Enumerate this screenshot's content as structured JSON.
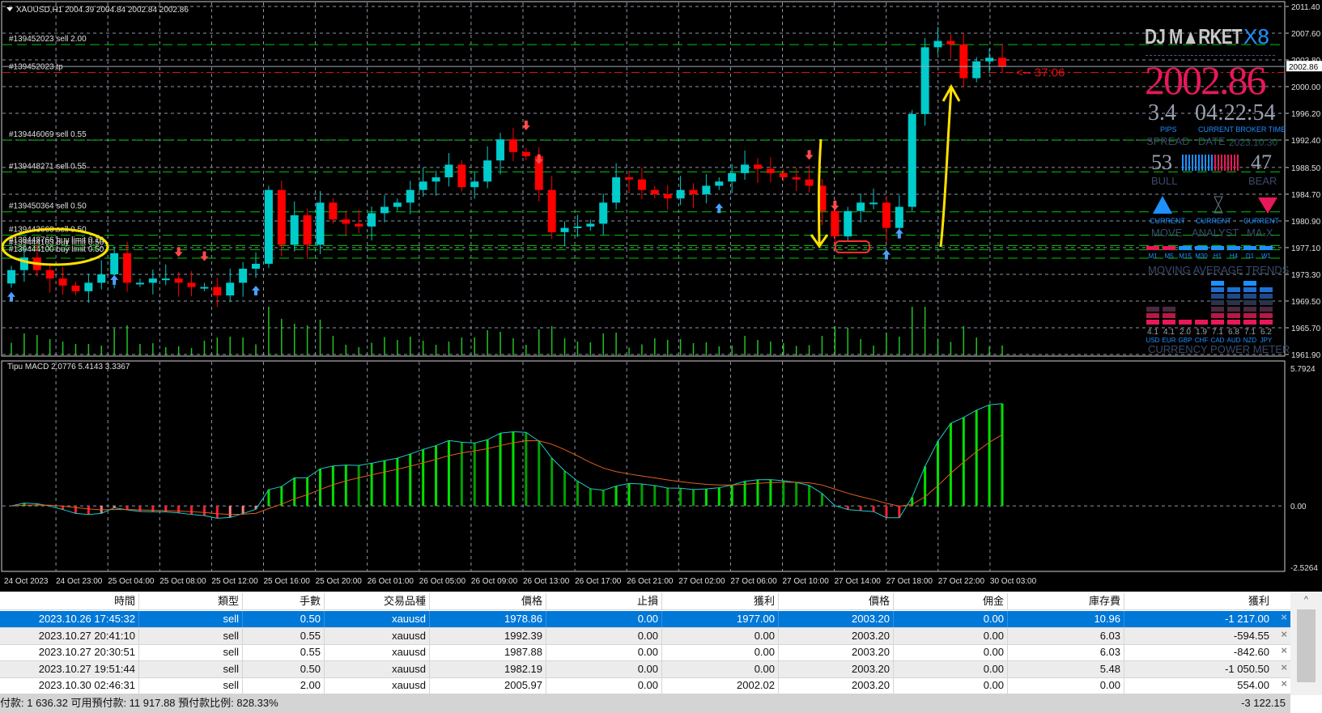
{
  "chart": {
    "title": "XAUUSD,H1",
    "ohlc_readout": "2004.39 2004.84 2002.84 2002.86",
    "price_axis": [
      "2011.40",
      "2007.60",
      "2003.80",
      "2000.00",
      "1996.20",
      "1992.40",
      "1988.50",
      "1984.70",
      "1980.90",
      "1977.10",
      "1973.30",
      "1969.50",
      "1965.70",
      "1961.90"
    ],
    "current_price": "2002.86",
    "countdown": "<-- 37:06",
    "time_axis": [
      "24 Oct 2023",
      "24 Oct 23:00",
      "25 Oct 04:00",
      "25 Oct 08:00",
      "25 Oct 12:00",
      "25 Oct 16:00",
      "25 Oct 20:00",
      "26 Oct 01:00",
      "26 Oct 05:00",
      "26 Oct 09:00",
      "26 Oct 13:00",
      "26 Oct 17:00",
      "26 Oct 21:00",
      "27 Oct 02:00",
      "27 Oct 06:00",
      "27 Oct 10:00",
      "27 Oct 14:00",
      "27 Oct 18:00",
      "27 Oct 22:00",
      "30 Oct 03:00"
    ],
    "order_lines": [
      {
        "label": "#139452023 sell 2.00",
        "price": 2005.97,
        "kind": "order"
      },
      {
        "label": "#139452023 tp",
        "price": 2002.02,
        "kind": "tp"
      },
      {
        "label": "#139446069 sell 0.55",
        "price": 1992.39,
        "kind": "order"
      },
      {
        "label": "#139448271 sell 0.55",
        "price": 1987.88,
        "kind": "order"
      },
      {
        "label": "#139450364 sell 0.50",
        "price": 1982.19,
        "kind": "order"
      },
      {
        "label": "#139443660 sell 0.50",
        "price": 1978.86,
        "kind": "order"
      },
      {
        "label": "#139448766 buy limit 0.10",
        "price": 1977.4,
        "kind": "order"
      },
      {
        "label": "#139444103 buy limit 0.50",
        "price": 1976.8,
        "kind": "order"
      },
      {
        "label": "#139444100 buy limit 0.50",
        "price": 1975.6,
        "kind": "order"
      }
    ],
    "colors": {
      "bull": "#00cccc",
      "bear": "#ff0000",
      "grid": "#8c96a6",
      "order_line": "#00c800",
      "tp_line": "#e01010",
      "volume": "#22c022",
      "macd_line": "#20c8c8",
      "signal_line": "#e06020",
      "hist_pos": "#00e000",
      "hist_neg": "#ff2030",
      "annotation": "#ffe000"
    }
  },
  "chart_data": [
    {
      "type": "candlestick",
      "title": "XAUUSD,H1",
      "ylim": [
        1961.9,
        2011.4
      ],
      "x_start": "24 Oct 2023",
      "x_end": "30 Oct 04:00",
      "close": [
        1973.9,
        1975.7,
        1973.9,
        1972.7,
        1971.7,
        1970.9,
        1972.1,
        1973.3,
        1976.3,
        1972.1,
        1972.1,
        1972.7,
        1972.7,
        1972.1,
        1971.5,
        1971.5,
        1970.3,
        1972.1,
        1974.1,
        1974.8,
        1985.3,
        1977.5,
        1981.7,
        1977.5,
        1983.5,
        1981.1,
        1980.5,
        1980.1,
        1982.0,
        1982.9,
        1983.5,
        1985.3,
        1986.5,
        1987.1,
        1988.9,
        1985.7,
        1986.5,
        1989.5,
        1992.5,
        1990.7,
        1990.1,
        1985.3,
        1979.3,
        1979.9,
        1980.1,
        1980.5,
        1983.5,
        1987.1,
        1986.8,
        1985.3,
        1984.7,
        1984.1,
        1985.3,
        1984.7,
        1985.9,
        1986.5,
        1987.7,
        1988.9,
        1988.3,
        1987.7,
        1987.1,
        1986.8,
        1985.9,
        1982.3,
        1978.7,
        1982.3,
        1983.5,
        1983.5,
        1979.9,
        1982.9,
        1996.1,
        2005.6,
        2006.5,
        2006.0,
        2001.2,
        2003.6,
        2004.1,
        2002.86
      ],
      "first_open": 1972.0,
      "signals": [
        {
          "i": 13,
          "dir": "down"
        },
        {
          "i": 15,
          "dir": "down"
        },
        {
          "i": 19,
          "dir": "up"
        },
        {
          "i": 41,
          "dir": "down"
        },
        {
          "i": 40,
          "dir": "down"
        },
        {
          "i": 55,
          "dir": "up"
        },
        {
          "i": 62,
          "dir": "down"
        },
        {
          "i": 64,
          "dir": "down"
        },
        {
          "i": 69,
          "dir": "up"
        },
        {
          "i": 68,
          "dir": "up"
        },
        {
          "i": 0,
          "dir": "up"
        },
        {
          "i": 8,
          "dir": "up"
        }
      ]
    },
    {
      "type": "line+bar",
      "title": "Tipu MACD 2.0776 5.4143 3.3367",
      "ylim": [
        -2.5264,
        5.7924
      ],
      "ticks": [
        "5.7924",
        "0.00",
        "-2.5264"
      ]
    }
  ],
  "macd": {
    "label": "Tipu MACD 2.0776 5.4143 3.3367",
    "axis": [
      "5.7924",
      "0.00",
      "-2.5264"
    ]
  },
  "dj_panel": {
    "logo": "DJ M▲RKET",
    "logo_suffix": "X8",
    "price": "2002.86",
    "spread": "3.4",
    "time": "04:22:54",
    "pips_label": "PIPS",
    "time_label": "CURRENT BROKER TIME",
    "spread_label": "SPREAD",
    "date_label": "DATE",
    "date": "2023.10.30",
    "bull": "53",
    "bear": "47",
    "bull_pct": 53,
    "bull_label": "BULL",
    "bear_label": "BEAR",
    "current": "CURRENT",
    "move_label": "MOVE",
    "analyst_label": "ANALYST",
    "max_label": "MA-X",
    "ma_trends": [
      {
        "tf": "M1",
        "dir": "down"
      },
      {
        "tf": "M5",
        "dir": "down"
      },
      {
        "tf": "M15",
        "dir": "up"
      },
      {
        "tf": "M30",
        "dir": "up"
      },
      {
        "tf": "H1",
        "dir": "up"
      },
      {
        "tf": "H4",
        "dir": "up"
      },
      {
        "tf": "D1",
        "dir": "up"
      },
      {
        "tf": "W1",
        "dir": "up"
      }
    ],
    "ma_title": "MOVING  AVERAGE  TRENDS",
    "currencies": [
      {
        "name": "USD",
        "value": "4.1",
        "level": 3,
        "color": "pink"
      },
      {
        "name": "EUR",
        "value": "4.1",
        "level": 3,
        "color": "pink"
      },
      {
        "name": "GBP",
        "value": "2.0",
        "level": 1,
        "color": "pink"
      },
      {
        "name": "CHF",
        "value": "1.9",
        "level": 1,
        "color": "pink"
      },
      {
        "name": "CAD",
        "value": "7.1",
        "level": 7,
        "color": "blue"
      },
      {
        "name": "AUD",
        "value": "6.8",
        "level": 6,
        "color": "blue"
      },
      {
        "name": "NZD",
        "value": "7.1",
        "level": 7,
        "color": "blue"
      },
      {
        "name": "JPY",
        "value": "6.2",
        "level": 6,
        "color": "blue"
      }
    ],
    "meter_title": "CURRENCY  POWER  METER",
    "colors": {
      "pink": "#e8185a",
      "blue": "#1e90ff",
      "label": "#3a4a6a",
      "text": "#9aa0b0"
    }
  },
  "terminal": {
    "headers": [
      "時間",
      "類型",
      "手數",
      "交易品種",
      "價格",
      "止損",
      "獲利",
      "價格",
      "佣金",
      "庫存費",
      "獲利"
    ],
    "rows": [
      [
        "2023.10.26 17:45:32",
        "sell",
        "0.50",
        "xauusd",
        "1978.86",
        "0.00",
        "1977.00",
        "2003.20",
        "0.00",
        "10.96",
        "-1 217.00"
      ],
      [
        "2023.10.27 20:41:10",
        "sell",
        "0.55",
        "xauusd",
        "1992.39",
        "0.00",
        "0.00",
        "2003.20",
        "0.00",
        "6.03",
        "-594.55"
      ],
      [
        "2023.10.27 20:30:51",
        "sell",
        "0.55",
        "xauusd",
        "1987.88",
        "0.00",
        "0.00",
        "2003.20",
        "0.00",
        "6.03",
        "-842.60"
      ],
      [
        "2023.10.27 19:51:44",
        "sell",
        "0.50",
        "xauusd",
        "1982.19",
        "0.00",
        "0.00",
        "2003.20",
        "0.00",
        "5.48",
        "-1 050.50"
      ],
      [
        "2023.10.30 02:46:31",
        "sell",
        "2.00",
        "xauusd",
        "2005.97",
        "0.00",
        "2002.02",
        "2003.20",
        "0.00",
        "0.00",
        "554.00"
      ]
    ],
    "selected_row": 0,
    "close_glyph": "×",
    "status": "付款: 1 636.32  可用預付款: 11 917.88  預付款比例: 828.33%",
    "total": "-3 122.15"
  }
}
